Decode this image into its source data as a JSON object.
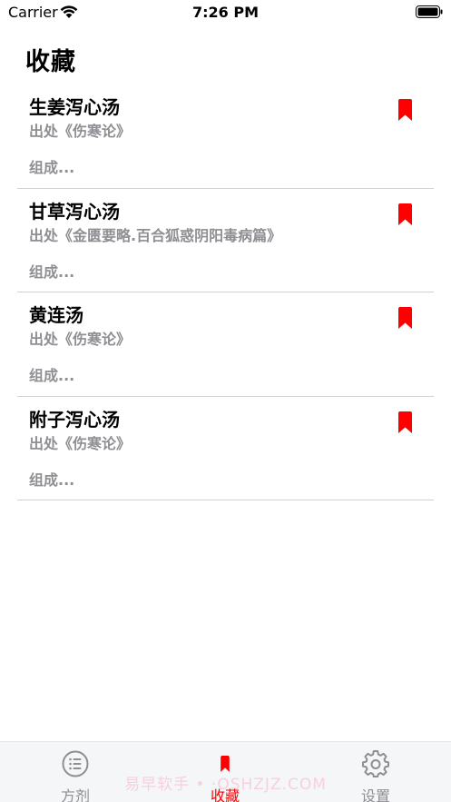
{
  "status_bar": {
    "carrier": "Carrier",
    "time": "7:26 PM"
  },
  "page": {
    "title": "收藏"
  },
  "favorites": [
    {
      "name": "生姜泻心汤",
      "source": "出处《伤寒论》",
      "composition": "组成..."
    },
    {
      "name": "甘草泻心汤",
      "source": "出处《金匮要略.百合狐惑阴阳毒病篇》",
      "composition": "组成..."
    },
    {
      "name": "黄连汤",
      "source": "出处《伤寒论》",
      "composition": "组成..."
    },
    {
      "name": "附子泻心汤",
      "source": "出处《伤寒论》",
      "composition": "组成..."
    }
  ],
  "tabs": [
    {
      "label": "方剂",
      "icon": "list-icon",
      "active": false
    },
    {
      "label": "收藏",
      "icon": "bookmark-icon",
      "active": true
    },
    {
      "label": "设置",
      "icon": "gear-icon",
      "active": false
    }
  ],
  "watermark": "易早软手 • ·OSHZJZ.COM",
  "colors": {
    "accent": "#ff0000",
    "secondary_text": "#8e8e93",
    "tab_inactive": "#8e8e93",
    "tab_bar_bg": "#f4f6f8",
    "divider": "#d1d1d6"
  }
}
